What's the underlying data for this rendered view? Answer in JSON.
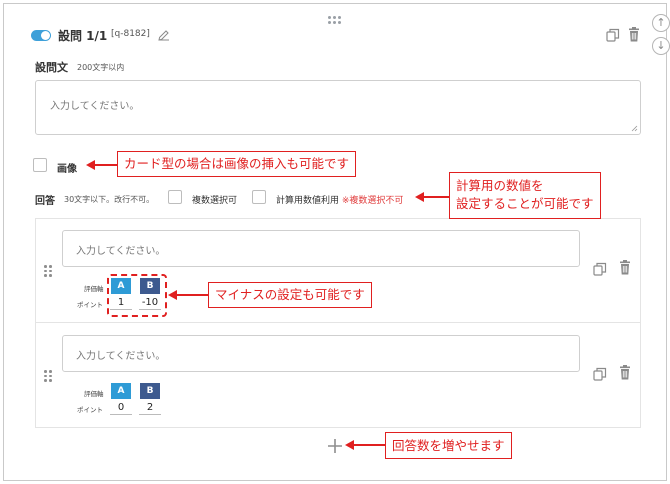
{
  "header": {
    "title": "設問 1/1",
    "id": "[q-8182]"
  },
  "question_text": {
    "label": "設問文",
    "hint": "200文字以内",
    "placeholder": "入力してください。"
  },
  "image": {
    "label": "画像"
  },
  "answer_section": {
    "label": "回答",
    "hint": "30文字以下。改行不可。",
    "multi_select_label": "複数選択可",
    "calc_label": "計算用数値利用",
    "calc_note": "※複数選択不可"
  },
  "answers": [
    {
      "placeholder": "入力してください。",
      "axis_label": "評価軸",
      "point_label": "ポイント",
      "axes": [
        "A",
        "B"
      ],
      "points": [
        "1",
        "-10"
      ]
    },
    {
      "placeholder": "入力してください。",
      "axis_label": "評価軸",
      "point_label": "ポイント",
      "axes": [
        "A",
        "B"
      ],
      "points": [
        "0",
        "2"
      ]
    }
  ],
  "callouts": {
    "image": "カード型の場合は画像の挿入も可能です",
    "calc_line1": "計算用の数値を",
    "calc_line2": "設定することが可能です",
    "minus": "マイナスの設定も可能です",
    "add": "回答数を増やせます"
  },
  "colors": {
    "toggle": "#3ea0d9",
    "badge_a": "#2e9bd6",
    "badge_b": "#3d5a8f",
    "callout_red": "#e02020"
  },
  "icons": {
    "drag": "drag-handle-icon",
    "copy": "copy-icon",
    "trash": "trash-icon",
    "edit": "pencil-icon",
    "up": "arrow-up-icon",
    "down": "arrow-down-icon",
    "add": "plus-icon"
  }
}
